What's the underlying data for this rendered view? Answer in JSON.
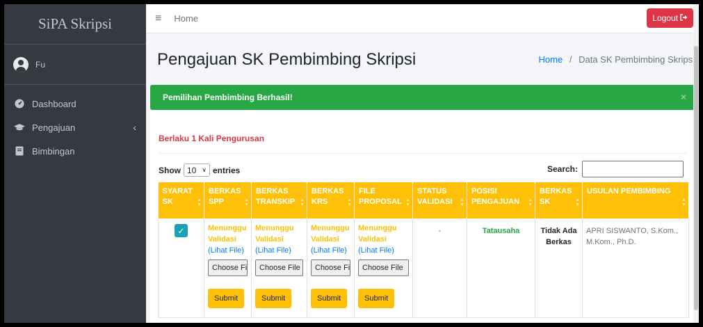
{
  "sidebar": {
    "brand": "SiPA Skripsi",
    "user_name": "Fu",
    "items": [
      {
        "label": "Dashboard",
        "icon": "tachometer-icon"
      },
      {
        "label": "Pengajuan",
        "icon": "graduation-cap-icon"
      },
      {
        "label": "Bimbingan",
        "icon": "book-icon"
      }
    ]
  },
  "topbar": {
    "home_label": "Home",
    "logout_label": "Logout"
  },
  "page": {
    "title": "Pengajuan SK Pembimbing Skripsi",
    "breadcrumb": {
      "home": "Home",
      "current": "Data SK Pembimbing Skripsi"
    }
  },
  "alert": {
    "message": "Pemilihan Pembimbing Berhasil!",
    "close": "×"
  },
  "card": {
    "note": "Berlaku 1 Kali Pengurusan",
    "show_label": "Show",
    "entries_value": "10",
    "entries_label": "entries",
    "search_label": "Search:"
  },
  "table": {
    "headers": [
      "SYARAT SK",
      "BERKAS SPP",
      "BERKAS TRANSKIP",
      "BERKAS KRS",
      "FILE PROPOSAL",
      "STATUS VALIDASI",
      "POSISI PENGAJUAN",
      "BERKAS SK",
      "USULAN PEMBIMBING"
    ],
    "row": {
      "files": [
        {
          "status": "Menunggu Validasi",
          "link": "(Lihat File)",
          "file_btn": "Choose Fi",
          "submit": "Submit"
        },
        {
          "status": "Menunggu Validasi",
          "link": "(Lihat File)",
          "file_btn": "Choose File",
          "submit": "Submit"
        },
        {
          "status": "Menunggu Validasi",
          "link": "(Lihat File)",
          "file_btn": "Choose Fi",
          "submit": "Submit"
        },
        {
          "status": "Menunggu Validasi",
          "link": "(Lihat File)",
          "file_btn": "Choose File",
          "submit": "Submit"
        }
      ],
      "status_validasi": "-",
      "posisi_pengajuan": "Tatausaha",
      "berkas_sk": "Tidak Ada Berkas",
      "usulan_pembimbing": "APRI SISWANTO, S.Kom., M.Kom., Ph.D."
    }
  },
  "colors": {
    "sidebar_bg": "#343a40",
    "alert_green": "#28a745",
    "header_yellow": "#ffc107",
    "logout_red": "#dc3545",
    "link_blue": "#007bff"
  }
}
